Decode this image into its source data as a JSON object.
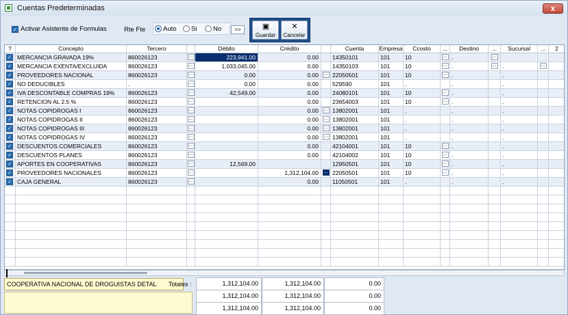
{
  "window": {
    "title": "Cuentas Predeterminadas",
    "close_label": "x"
  },
  "toolbar": {
    "asistente_label": "Activar Asistente de Formulas",
    "rte_fte_label": "Rte Fte",
    "radio_auto": "Auto",
    "radio_si": "Si",
    "radio_no": "No",
    "radio_selected": "Auto",
    "more_label": ">>",
    "guardar_label": "Guardar",
    "cancelar_label": "Cancelar"
  },
  "grid": {
    "columns": [
      "?",
      "Concepto",
      "Tercero",
      "",
      "Débito",
      "Crédito",
      "",
      "Cuenta",
      "Empresa",
      "Ccosto",
      "...",
      "Destino",
      "...",
      "Sucursal",
      "...",
      "2"
    ],
    "dots_label": "...",
    "rows": [
      {
        "concepto": "MERCANCIA GRAVADA 19%",
        "tercero": "860026123",
        "debito": "223,941.00",
        "credito": "0.00",
        "cuenta": "14350101",
        "empresa": "101",
        "ccosto": "10",
        "destino": ".",
        "sucursal": "",
        "ccosto_btn": true,
        "destino_btn": true,
        "sucursal_btn": true,
        "credito_btn": false
      },
      {
        "concepto": "MERCANCIA EXENTA/EXCLUIDA",
        "tercero": "860026123",
        "debito": "1,033,045.00",
        "credito": "0.00",
        "cuenta": "14350103",
        "empresa": "101",
        "ccosto": "10",
        "destino": ".",
        "sucursal": ".",
        "ccosto_btn": true,
        "destino_btn": true,
        "sucursal_btn": true,
        "credito_btn": false
      },
      {
        "concepto": "PROVEEDORES NACIONAL",
        "tercero": "860026123",
        "debito": "0.00",
        "credito": "0.00",
        "cuenta": "22050501",
        "empresa": "101",
        "ccosto": "10",
        "destino": ".",
        "sucursal": ".",
        "ccosto_btn": true,
        "destino_btn": false,
        "sucursal_btn": false,
        "credito_btn": true
      },
      {
        "concepto": "NO DEDUCIBLES",
        "tercero": ".",
        "debito": "0.00",
        "credito": "0.00",
        "cuenta": "529590",
        "empresa": "101",
        "ccosto": ".",
        "destino": ".",
        "sucursal": ".",
        "ccosto_btn": false,
        "destino_btn": false,
        "sucursal_btn": false,
        "credito_btn": false
      },
      {
        "concepto": "IVA DESCONTABLE COMPRAS 19%",
        "tercero": "860026123",
        "debito": "42,549.00",
        "credito": "0.00",
        "cuenta": "24080101",
        "empresa": "101",
        "ccosto": "10",
        "destino": ".",
        "sucursal": ".",
        "ccosto_btn": true,
        "destino_btn": false,
        "sucursal_btn": false,
        "credito_btn": false
      },
      {
        "concepto": "RETENCION AL  2.5 %",
        "tercero": "860026123",
        "debito": "",
        "credito": "0.00",
        "cuenta": "23654003",
        "empresa": "101",
        "ccosto": "10",
        "destino": ".",
        "sucursal": ".",
        "ccosto_btn": true,
        "destino_btn": false,
        "sucursal_btn": false,
        "credito_btn": false
      },
      {
        "concepto": "NOTAS COPIDROGAS I",
        "tercero": "860026123",
        "debito": "",
        "credito": "0.00",
        "cuenta": "13802001",
        "empresa": "101",
        "ccosto": ".",
        "destino": ".",
        "sucursal": ".",
        "ccosto_btn": false,
        "destino_btn": false,
        "sucursal_btn": false,
        "credito_btn": true
      },
      {
        "concepto": "NOTAS COPIDROGAS II",
        "tercero": "860026123",
        "debito": "",
        "credito": "0.00",
        "cuenta": "13802001",
        "empresa": "101",
        "ccosto": ".",
        "destino": ".",
        "sucursal": ".",
        "ccosto_btn": false,
        "destino_btn": false,
        "sucursal_btn": false,
        "credito_btn": true
      },
      {
        "concepto": "NOTAS COPIDROGAS III",
        "tercero": "860026123",
        "debito": "",
        "credito": "0.00",
        "cuenta": "13802001",
        "empresa": "101",
        "ccosto": ".",
        "destino": ".",
        "sucursal": ".",
        "ccosto_btn": false,
        "destino_btn": false,
        "sucursal_btn": false,
        "credito_btn": true
      },
      {
        "concepto": "NOTAS COPIDROGAS IV",
        "tercero": "860026123",
        "debito": "",
        "credito": "0.00",
        "cuenta": "13802001",
        "empresa": "101",
        "ccosto": ".",
        "destino": ".",
        "sucursal": ".",
        "ccosto_btn": false,
        "destino_btn": false,
        "sucursal_btn": false,
        "credito_btn": true
      },
      {
        "concepto": "DESCUENTOS COMERCIALES",
        "tercero": "860026123",
        "debito": "",
        "credito": "0.00",
        "cuenta": "42104001",
        "empresa": "101",
        "ccosto": "10",
        "destino": ".",
        "sucursal": ".",
        "ccosto_btn": true,
        "destino_btn": false,
        "sucursal_btn": false,
        "credito_btn": false
      },
      {
        "concepto": "DESCUENTOS PLANES",
        "tercero": "860026123",
        "debito": "",
        "credito": "0.00",
        "cuenta": "42104002",
        "empresa": "101",
        "ccosto": "10",
        "destino": ".",
        "sucursal": ".",
        "ccosto_btn": true,
        "destino_btn": false,
        "sucursal_btn": false,
        "credito_btn": false
      },
      {
        "concepto": "APORTES EN COOPERATIVAS",
        "tercero": "860026123",
        "debito": "12,569.00",
        "credito": "",
        "cuenta": "12950501",
        "empresa": "101",
        "ccosto": "10",
        "destino": ".",
        "sucursal": ".",
        "ccosto_btn": true,
        "destino_btn": false,
        "sucursal_btn": false,
        "credito_btn": false
      },
      {
        "concepto": "PROVEEDORES NACIONALES",
        "tercero": "860026123",
        "debito": "",
        "credito": "1,312,104.00",
        "cuenta": "22050501",
        "empresa": "101",
        "ccosto": "10",
        "destino": ".",
        "sucursal": ".",
        "ccosto_btn": true,
        "destino_btn": false,
        "sucursal_btn": false,
        "credito_btn": true
      },
      {
        "concepto": "CAJA GENERAL",
        "tercero": "860026123",
        "debito": "",
        "credito": "0.00",
        "cuenta": "11050501",
        "empresa": "101",
        "ccosto": ".",
        "destino": ".",
        "sucursal": ".",
        "ccosto_btn": false,
        "destino_btn": false,
        "sucursal_btn": false,
        "credito_btn": false
      }
    ],
    "empty_rows": 9
  },
  "footer": {
    "description": "COOPERATIVA NACIONAL DE DROGUISTAS DETAL",
    "totales_label": "Totales :",
    "totals": [
      [
        "1,312,104.00",
        "1,312,104.00",
        "0.00"
      ],
      [
        "1,312,104.00",
        "1,312,104.00",
        "0.00"
      ],
      [
        "1,312,104.00",
        "1,312,104.00",
        "0.00"
      ]
    ]
  },
  "colors": {
    "accent": "#1f4f8a",
    "selected_cell": "#0a2f6e",
    "check": "#2b6fb3",
    "description_bg": "#fffbd1"
  }
}
